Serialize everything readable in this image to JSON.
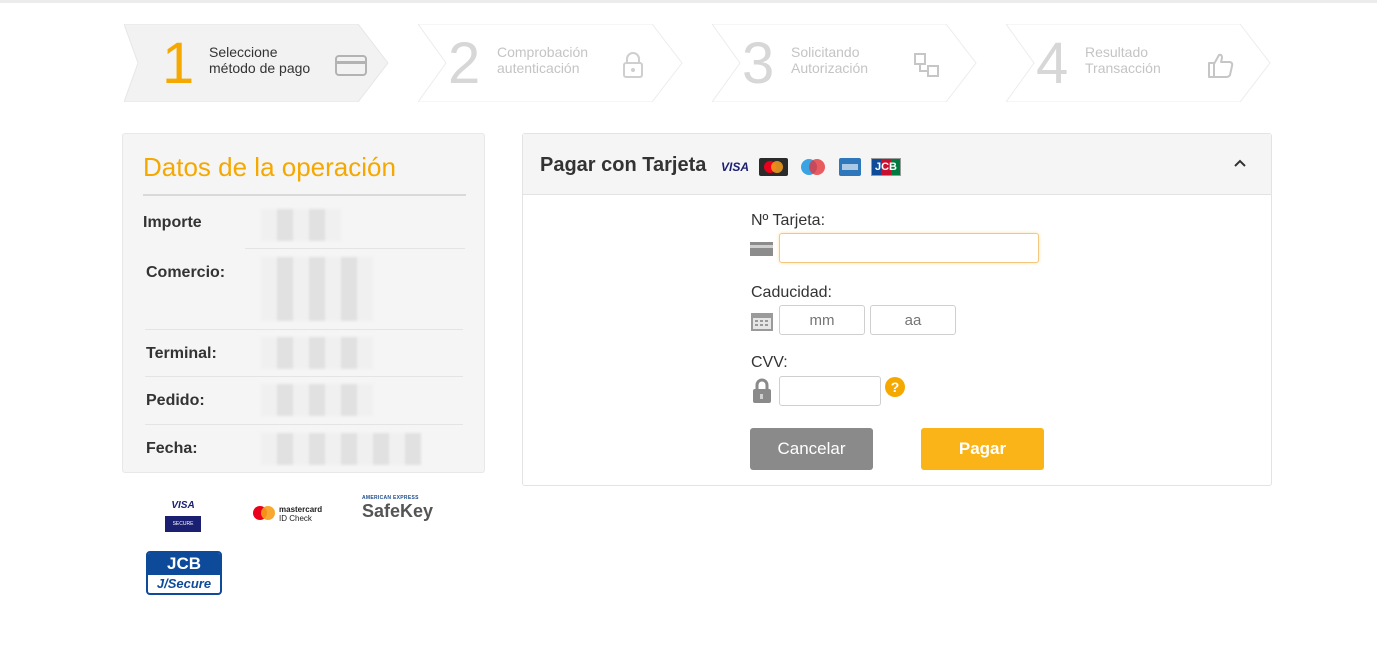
{
  "steps": [
    {
      "number": "1",
      "line1": "Seleccione",
      "line2": "método de pago",
      "icon": "credit-card-icon"
    },
    {
      "number": "2",
      "line1": "Comprobación",
      "line2": "autenticación",
      "icon": "lock-icon"
    },
    {
      "number": "3",
      "line1": "Solicitando",
      "line2": "Autorización",
      "icon": "transfer-icon"
    },
    {
      "number": "4",
      "line1": "Resultado",
      "line2": "Transacción",
      "icon": "thumbs-up-icon"
    }
  ],
  "operation": {
    "title": "Datos de la operación",
    "rows": [
      {
        "label": "Importe"
      },
      {
        "label": "Comercio:"
      },
      {
        "label": "Terminal:"
      },
      {
        "label": "Pedido:"
      },
      {
        "label": "Fecha:"
      }
    ]
  },
  "security_logos": {
    "visa": {
      "top": "VISA",
      "bottom": "SECURE"
    },
    "mastercard": {
      "line1": "mastercard",
      "line2": "ID Check"
    },
    "amex": {
      "top": "AMERICAN EXPRESS",
      "main": "SafeKey"
    },
    "jcb": {
      "top": "JCB",
      "bottom": "J/Secure"
    }
  },
  "payment": {
    "title": "Pagar con Tarjeta",
    "brands": {
      "visa": "VISA",
      "jcb": "JCB"
    },
    "card_label": "Nº Tarjeta:",
    "card_value": "",
    "expiry_label": "Caducidad:",
    "month_placeholder": "mm",
    "year_placeholder": "aa",
    "cvv_label": "CVV:",
    "cvv_value": "",
    "cancel_label": "Cancelar",
    "pay_label": "Pagar"
  },
  "colors": {
    "accent": "#f5a800",
    "pay_button": "#fbb417",
    "cancel_button": "#8a8a8a"
  }
}
